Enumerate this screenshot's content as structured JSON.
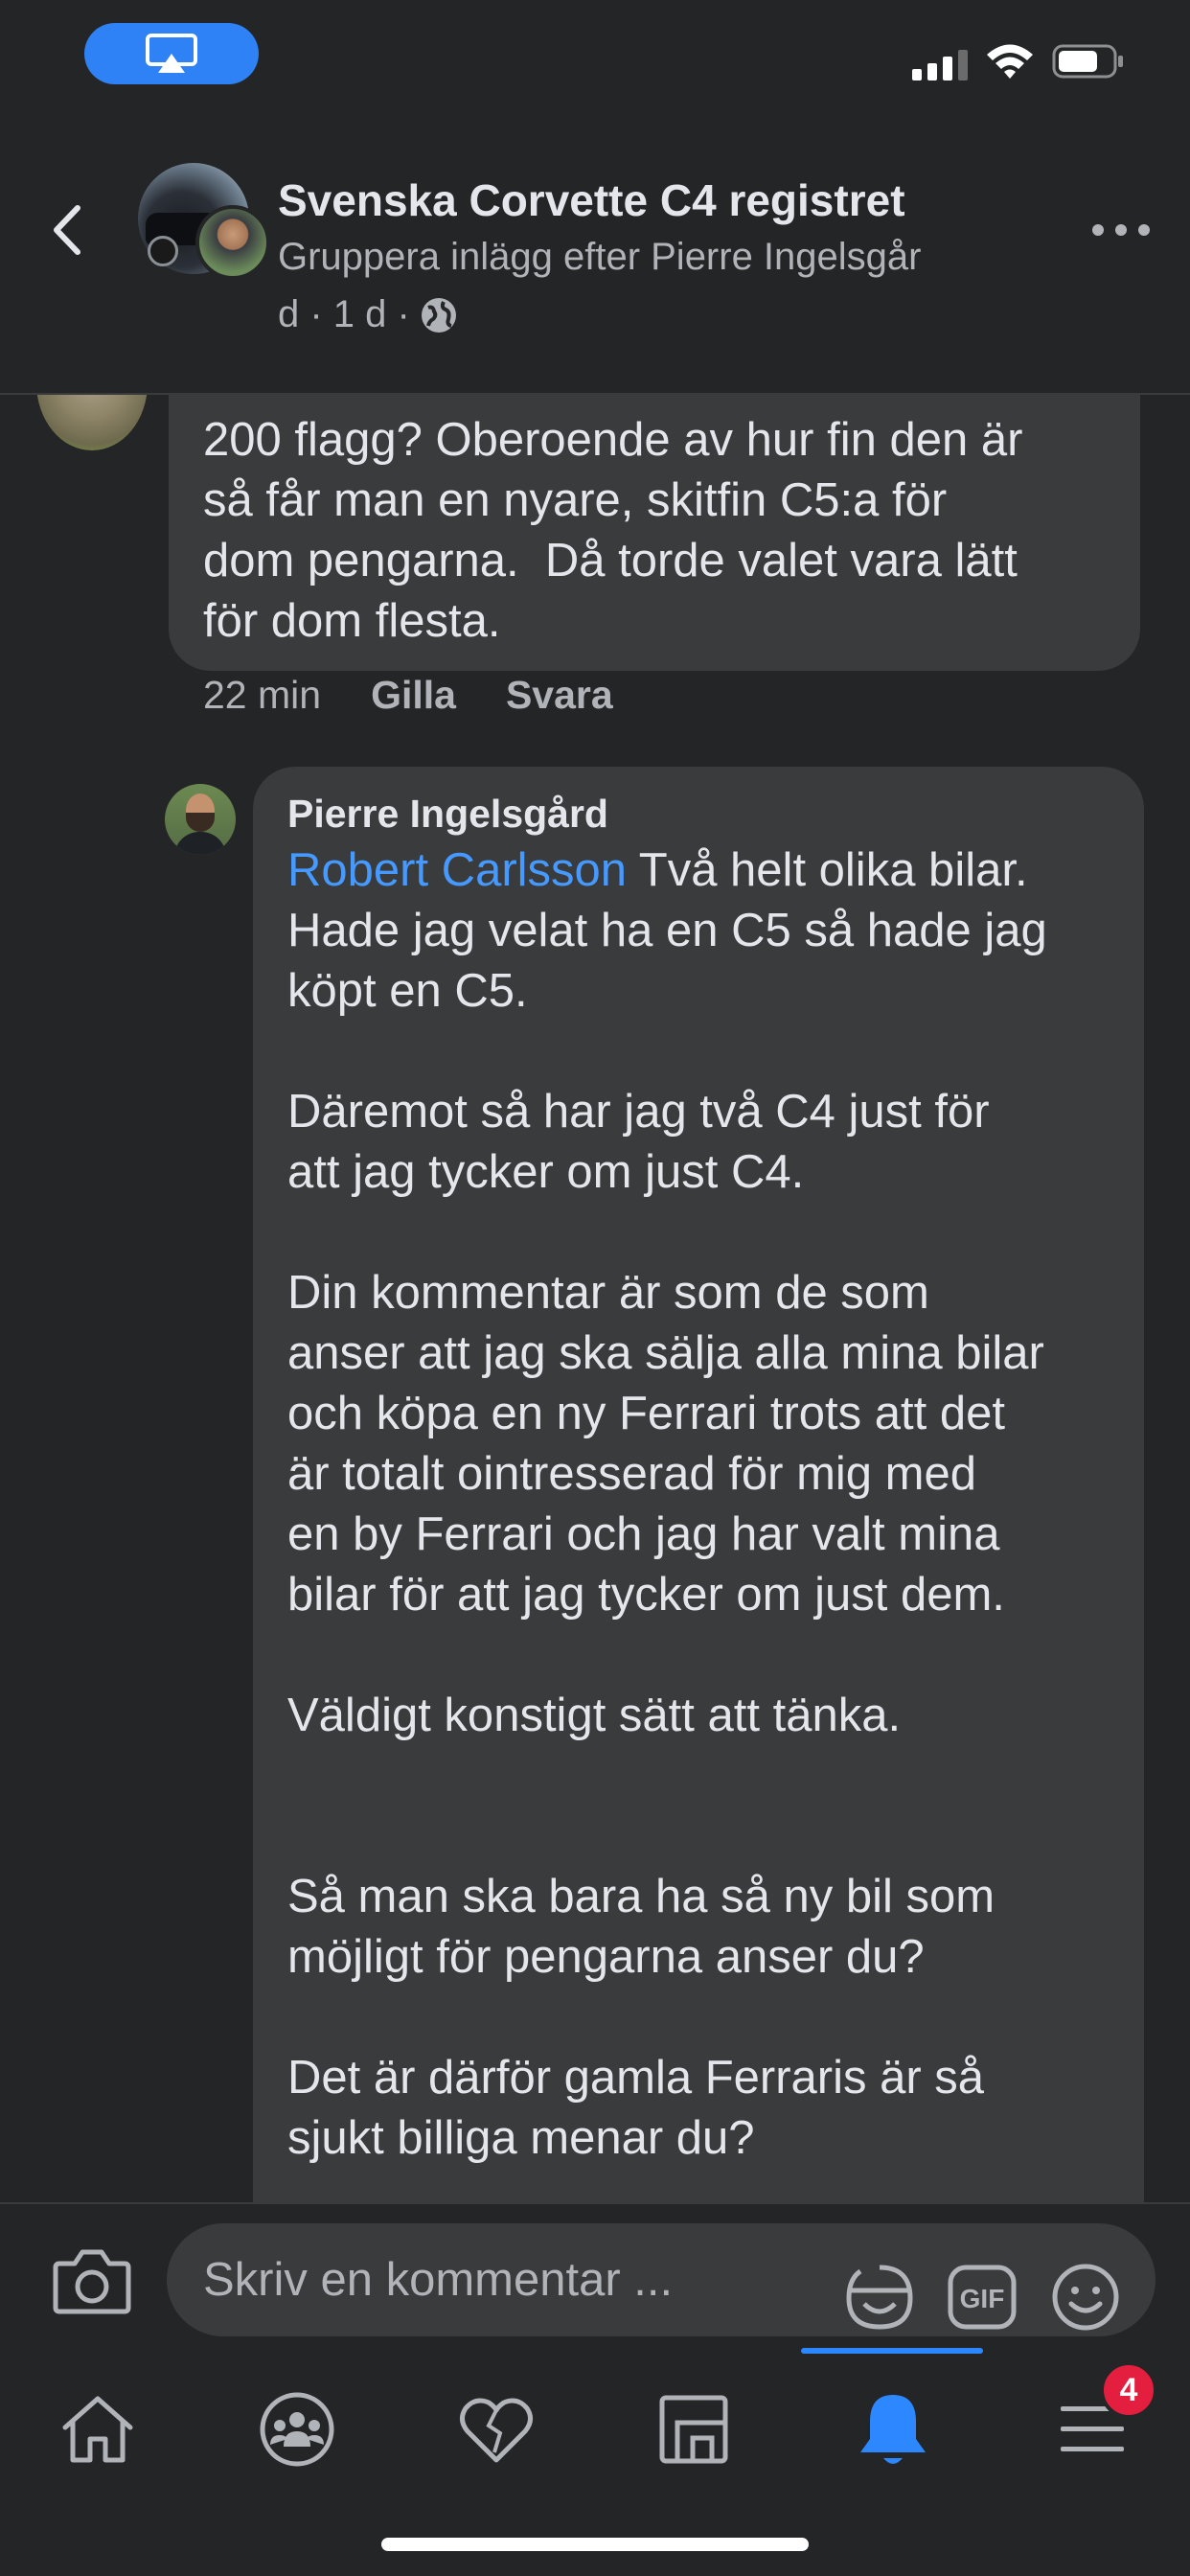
{
  "status_bar": {
    "icons": [
      "airplay-icon",
      "signal-icon",
      "wifi-icon",
      "battery-icon"
    ]
  },
  "header": {
    "title": "Svenska Corvette C4 registret",
    "subtitle": "Gruppera inlägg efter Pierre Ingelsgår",
    "meta": "d · 1 d ·",
    "icons": [
      "back-arrow-icon",
      "globe-icon",
      "more-icon"
    ]
  },
  "comment": {
    "text": "200 flagg? Oberoende av hur fin den är\nså får man en nyare, skitfin C5:a för\ndom pengarna.  Då torde valet vara lätt\nför dom flesta.",
    "time": "22 min",
    "like_label": "Gilla",
    "reply_label": "Svara"
  },
  "reply": {
    "author": "Pierre Ingelsgård",
    "mention": "Robert Carlsson",
    "text_after_mention": " Två helt olika bilar.\nHade jag velat ha en C5 så hade jag\nköpt en C5.\n\nDäremot så har jag två C4 just för\natt jag tycker om just C4.\n\nDin kommentar är som de som\nanser att jag ska sälja alla mina bilar\noch köpa en ny Ferrari trots att det\när totalt ointresserad för mig med\nen by Ferrari och jag har valt mina\nbilar för att jag tycker om just dem.\n\nVäldigt konstigt sätt att tänka.\n\n\nSå man ska bara ha så ny bil som\nmöjligt för pengarna anser du?\n\nDet är därför gamla Ferraris är så\nsjukt billiga menar du?"
  },
  "composer": {
    "placeholder": "Skriv en kommentar ...",
    "gif_label": "GIF",
    "icons": [
      "camera-icon",
      "sticker-icon",
      "gif-icon",
      "emoji-icon"
    ]
  },
  "tabs": {
    "items": [
      "home",
      "groups",
      "dating",
      "pages",
      "notifications",
      "menu"
    ],
    "active": "notifications",
    "menu_badge": "4"
  },
  "colors": {
    "background": "#242526",
    "bubble": "#3a3b3c",
    "accent": "#2d88ff",
    "mention": "#4599ff",
    "badge": "#e41e3f"
  }
}
